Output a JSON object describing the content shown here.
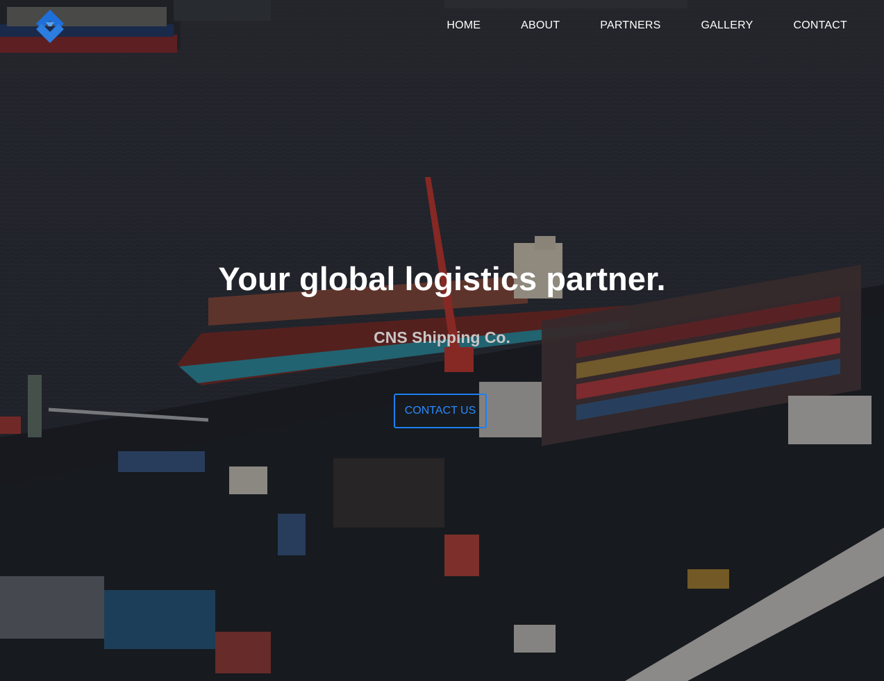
{
  "brand": {
    "logo_icon": "diamond-logo-icon",
    "accent_color": "#1e7ff0"
  },
  "nav": {
    "items": [
      {
        "label": "HOME"
      },
      {
        "label": "ABOUT"
      },
      {
        "label": "PARTNERS"
      },
      {
        "label": "GALLERY"
      },
      {
        "label": "CONTACT"
      }
    ]
  },
  "hero": {
    "title": "Your global logistics partner.",
    "subtitle": "CNS Shipping Co.",
    "cta_label": "CONTACT US",
    "background": "aerial-port-photo"
  }
}
